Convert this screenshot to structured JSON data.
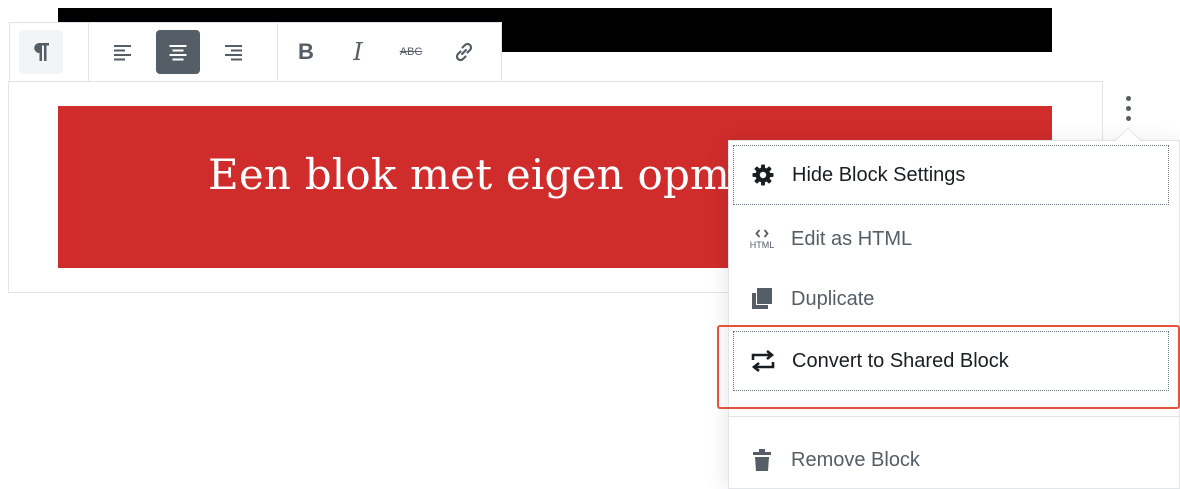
{
  "editor": {
    "banner_text": "Een blok met eigen opmaak",
    "banner_color": "#d02c2c"
  },
  "toolbar": {
    "paragraph": "paragraph-icon",
    "align_left": "align-left-icon",
    "align_center": "align-center-icon",
    "align_right": "align-right-icon",
    "bold": "B",
    "italic": "I",
    "strikethrough": "ABC",
    "link": "link-icon"
  },
  "menu": {
    "items": [
      {
        "label": "Hide Block Settings",
        "icon": "gear-icon"
      },
      {
        "label": "Edit as HTML",
        "icon": "html-icon",
        "icon_text": "HTML"
      },
      {
        "label": "Duplicate",
        "icon": "duplicate-icon"
      },
      {
        "label": "Convert to Shared Block",
        "icon": "convert-icon"
      },
      {
        "label": "Remove Block",
        "icon": "trash-icon"
      }
    ],
    "highlight_color": "#e5533a"
  }
}
